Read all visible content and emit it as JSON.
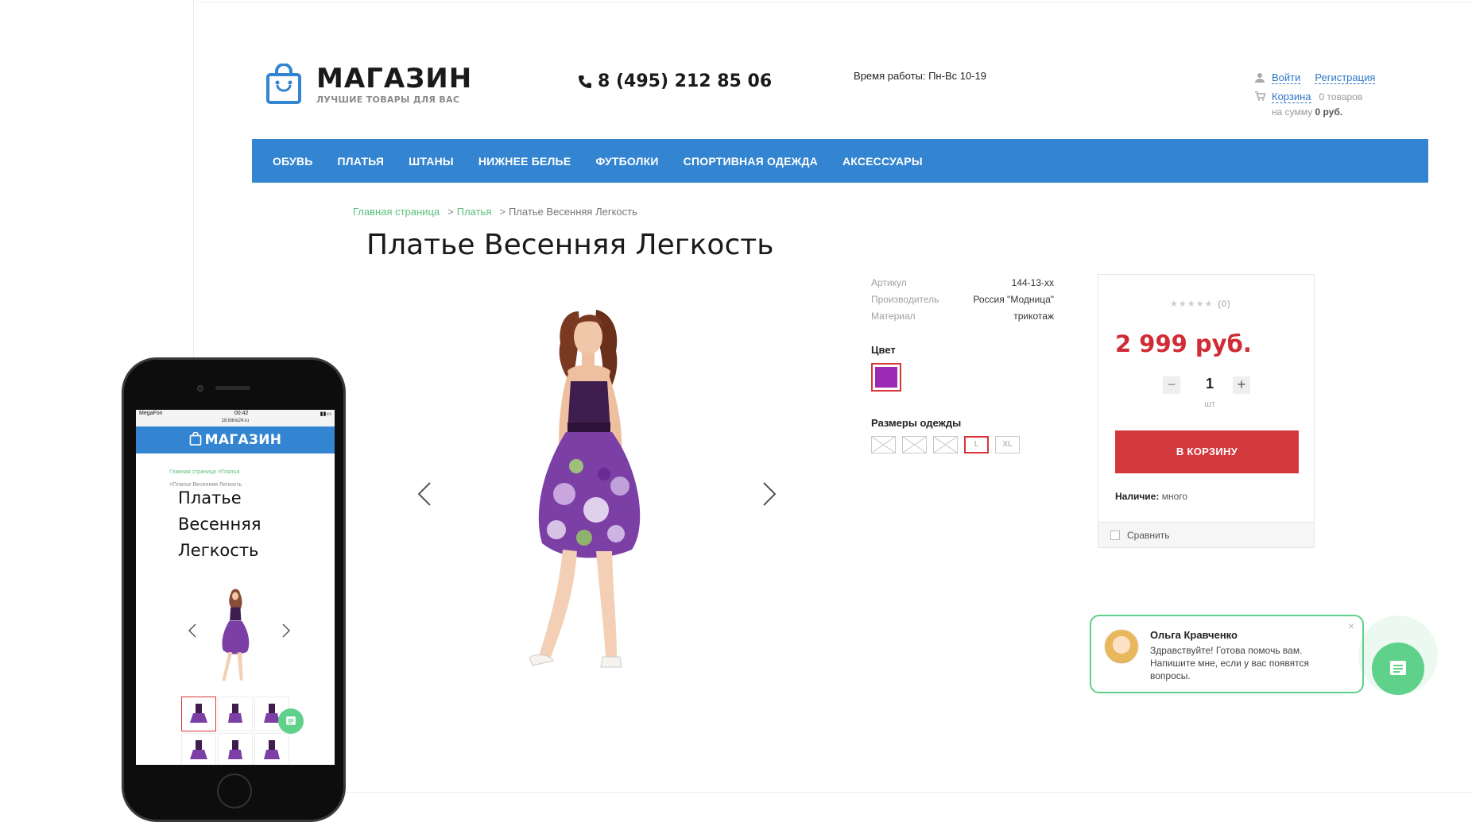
{
  "header": {
    "logo_title": "МАГАЗИН",
    "logo_subtitle": "ЛУЧШИЕ ТОВАРЫ ДЛЯ ВАС",
    "phone": "8 (495) 212 85 06",
    "hours": "Время работы: Пн-Вс 10-19",
    "login": "Войти",
    "register": "Регистрация",
    "cart_link": "Корзина",
    "cart_count": "0 товаров",
    "cart_sum_label": "на сумму",
    "cart_sum_value": "0 руб."
  },
  "nav": [
    "ОБУВЬ",
    "ПЛАТЬЯ",
    "ШТАНЫ",
    "НИЖНЕЕ БЕЛЬЕ",
    "ФУТБОЛКИ",
    "СПОРТИВНАЯ ОДЕЖДА",
    "АКСЕССУАРЫ"
  ],
  "breadcrumb": {
    "home": "Главная страница",
    "sep": ">",
    "category": "Платья",
    "current": "Платье Весенняя Легкость"
  },
  "product": {
    "title": "Платье Весенняя Легкость",
    "props": [
      {
        "key": "Артикул",
        "value": "144-13-хх"
      },
      {
        "key": "Производитель",
        "value": "Россия \"Модница\""
      },
      {
        "key": "Материал",
        "value": "трикотаж"
      }
    ],
    "color_label": "Цвет",
    "color_value": "#9b2bb5",
    "sizes_label": "Размеры одежды",
    "sizes": [
      {
        "label": "",
        "available": false
      },
      {
        "label": "",
        "available": false
      },
      {
        "label": "",
        "available": false
      },
      {
        "label": "L",
        "available": true,
        "selected": true
      },
      {
        "label": "XL",
        "available": true
      }
    ]
  },
  "buy": {
    "stars": "★★★★★",
    "rating_count": "(0)",
    "price": "2 999 руб.",
    "qty_minus": "−",
    "qty": "1",
    "qty_plus": "+",
    "unit": "шт",
    "cart_button": "В КОРЗИНУ",
    "availability_label": "Наличие:",
    "availability_value": "много",
    "compare": "Сравнить"
  },
  "chat": {
    "name": "Ольга Кравченко",
    "message": "Здравствуйте! Готова помочь вам. Напишите мне, если у вас появятся вопросы.",
    "close": "×"
  },
  "mobile": {
    "carrier": "MegaFon",
    "time": "00:42",
    "url": "18.bitrix24.ru",
    "header": "МАГАЗИН",
    "crumb_home": "Главная страница",
    "crumb_category": "Платья",
    "crumb_current": "Платье Весенняя Легкость",
    "title_lines": [
      "Платье",
      "Весенняя",
      "Легкость"
    ]
  },
  "colors": {
    "brand_blue": "#3384d1",
    "price_red": "#cf2c36",
    "button_red": "#d3383c",
    "chat_green": "#5fd18b",
    "link_green": "#5bbf7a"
  }
}
